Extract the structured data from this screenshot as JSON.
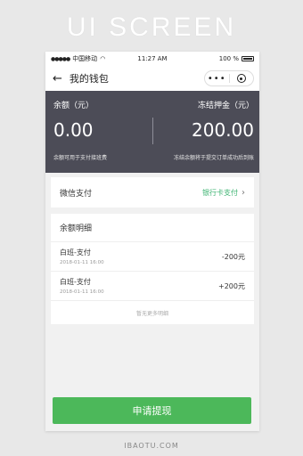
{
  "banner": "UI SCREEN",
  "status": {
    "carrier": "中国移动",
    "time": "11:27 AM",
    "battery": "100 %"
  },
  "nav": {
    "back_icon": "back-arrow-icon",
    "title": "我的钱包",
    "more": "•••"
  },
  "balance": {
    "label": "余额（元）",
    "amount": "0.00",
    "note": "余额可用于支付接班费"
  },
  "deposit": {
    "label": "冻结押金（元）",
    "amount": "200.00",
    "note": "冻结余额将于提交订单成功后到账"
  },
  "payment": {
    "method": "微信支付",
    "bank_link": "银行卡支付",
    "chevron": "›"
  },
  "details": {
    "title": "余额明细",
    "rows": [
      {
        "name": "白班-支付",
        "time": "2018-01-11 16:00",
        "amount": "-200元"
      },
      {
        "name": "白班-支付",
        "time": "2018-01-11 16:00",
        "amount": "+200元"
      }
    ],
    "no_more": "暂无更多明细"
  },
  "action": {
    "withdraw": "申请提现"
  },
  "footer": "IBAOTU.COM",
  "colors": {
    "dark_panel": "#4c4c57",
    "accent_green": "#4cb85a",
    "link_green": "#3cb371"
  }
}
